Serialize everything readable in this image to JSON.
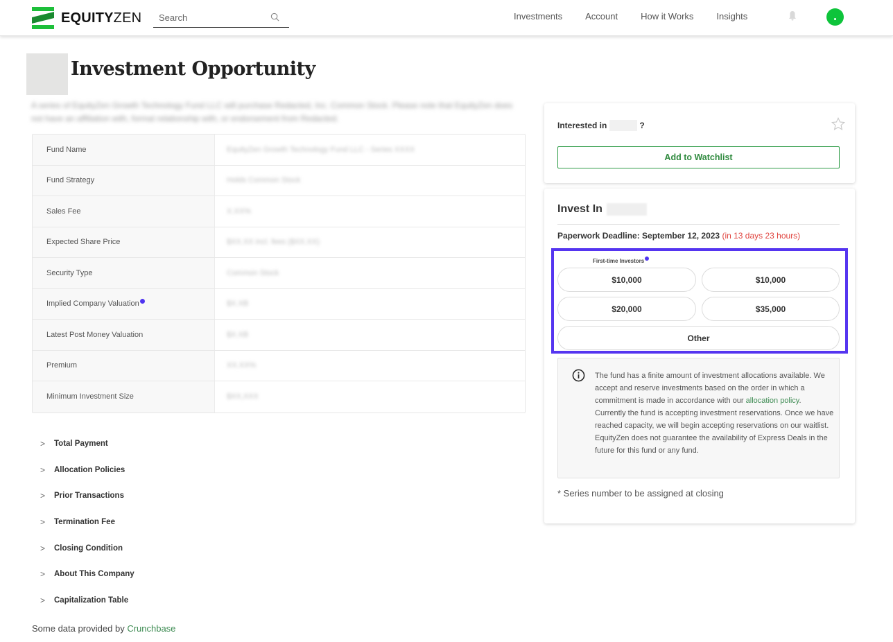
{
  "header": {
    "logo_bold": "EQUITY",
    "logo_light": "ZEN",
    "search_placeholder": "Search",
    "nav": [
      "Investments",
      "Account",
      "How it Works",
      "Insights"
    ],
    "icons": {
      "search": "search-icon",
      "bell": "bell-icon",
      "avatar": "avatar"
    },
    "brand_color": "#1dbf3a"
  },
  "page": {
    "title": "Investment Opportunity",
    "description": "A series of EquityZen Growth Technology Fund LLC will purchase Redacted, Inc. Common Stock. Please note that EquityZen does not have an affiliation with, formal relationship with, or endorsement from Redacted."
  },
  "details": [
    {
      "label": "Fund Name",
      "value": "EquityZen Growth Technology Fund LLC - Series XXXX",
      "info": false
    },
    {
      "label": "Fund Strategy",
      "value": "Holds Common Stock",
      "info": false
    },
    {
      "label": "Sales Fee",
      "value": "X.XX%",
      "info": false
    },
    {
      "label": "Expected Share Price",
      "value": "$XX.XX incl. fees ($XX.XX)",
      "info": false
    },
    {
      "label": "Security Type",
      "value": "Common Stock",
      "info": false
    },
    {
      "label": "Implied Company Valuation",
      "value": "$X.XB",
      "info": true
    },
    {
      "label": "Latest Post Money Valuation",
      "value": "$X.XB",
      "info": false
    },
    {
      "label": "Premium",
      "value": "XX.XX%",
      "info": false
    },
    {
      "label": "Minimum Investment Size",
      "value": "$XX,XXX",
      "info": false
    }
  ],
  "accordions": [
    "Total Payment",
    "Allocation Policies",
    "Prior Transactions",
    "Termination Fee",
    "Closing Condition",
    "About This Company",
    "Capitalization Table"
  ],
  "footer": {
    "prefix": "Some data provided by ",
    "link": "Crunchbase"
  },
  "watchlist": {
    "interested_prefix": "Interested in",
    "interested_suffix": "?",
    "button": "Add to Watchlist",
    "accent": "#2f9c47"
  },
  "invest": {
    "title": "Invest In",
    "deadline_label": "Paperwork Deadline: September 12, 2023",
    "countdown": "(in 13 days 23 hours)",
    "countdown_color": "#e0443f",
    "first_time_label": "First-time Investors",
    "amounts": [
      "$10,000",
      "$10,000",
      "$20,000",
      "$35,000"
    ],
    "other": "Other",
    "highlight_color": "#5535f0",
    "notice_before_link": "The fund has a finite amount of investment allocations available. We accept and reserve investments based on the order in which a commitment is made in accordance with our ",
    "notice_link": "allocation policy",
    "notice_after_link": ". Currently the fund is accepting investment reservations. Once we have reached capacity, we will begin accepting reservations on our waitlist. EquityZen does not guarantee the availability of Express Deals in the future for this fund or any fund.",
    "series_note": "* Series number to be assigned at closing"
  }
}
